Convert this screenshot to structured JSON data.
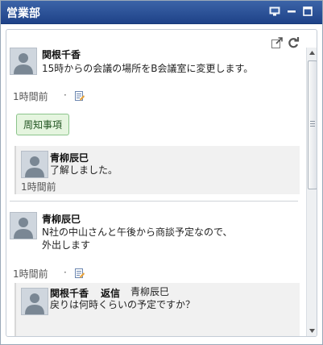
{
  "window": {
    "title": "営業部"
  },
  "posts": [
    {
      "author": "関根千香",
      "message": "15時からの会議の場所をB会議室に変更します。",
      "time": "1時間前",
      "time_separator": "·",
      "tag": "周知事項",
      "reply": {
        "author": "青柳辰巳",
        "message": "了解しました。",
        "time": "1時間前"
      }
    },
    {
      "author": "青柳辰巳",
      "message_lines": [
        "N社の中山さんと午後から商談予定なので、",
        "外出します"
      ],
      "time": "1時間前",
      "time_separator": "·",
      "reply": {
        "author": "関根千香",
        "reply_label": "返信",
        "reply_to": "青柳辰巳",
        "message": "戻りは何時くらいの予定ですか？"
      }
    }
  ],
  "icons": {
    "titlebar": [
      "monitor-icon",
      "minimize-icon",
      "maximize-icon"
    ],
    "panel_tools": [
      "popout-icon",
      "refresh-icon"
    ],
    "post_action": "reply-memo-icon"
  },
  "colors": {
    "titlebar": "#2a4f96",
    "tag_background": "#e5f5df",
    "tag_border": "#8bc48b"
  }
}
